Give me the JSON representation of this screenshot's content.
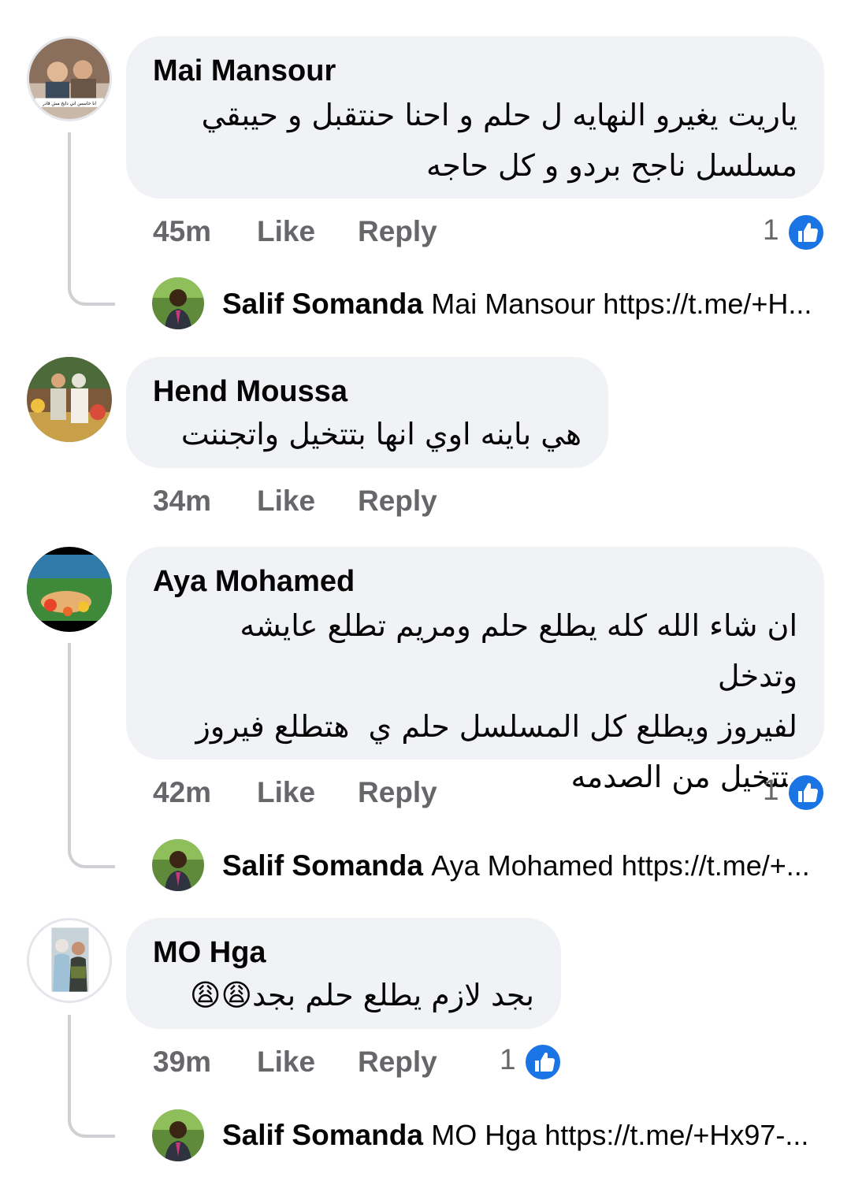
{
  "comments": [
    {
      "author": "Mai Mansour",
      "text_lines": [
        "ياريت يغيرو النهايه ل حلم و احنا حنتقبل و حيبقي",
        "مسلسل ناجح بردو و كل حاجه"
      ],
      "avatar_caption": "انا حاسس اني دايخ مش قادر",
      "time": "45m",
      "like_label": "Like",
      "reply_label": "Reply",
      "reaction_count": "1",
      "reaction_icon": "like-icon",
      "reply": {
        "author": "Salif Somanda",
        "text": "Mai Mansour https://t.me/+H..."
      }
    },
    {
      "author": "Hend Moussa",
      "text_lines": [
        "هي باينه اوي انها بتتخيل واتجننت"
      ],
      "time": "34m",
      "like_label": "Like",
      "reply_label": "Reply"
    },
    {
      "author": "Aya Mohamed",
      "text_lines": [
        "ان شاء الله كله يطلع حلم ومريم تطلع عايشه وتدخل",
        "لفيروز ويطلع كل المسلسل حلم ي  هتطلع فيروز",
        "بتتخيل من الصدمه"
      ],
      "time": "42m",
      "like_label": "Like",
      "reply_label": "Reply",
      "reaction_count": "1",
      "reaction_icon": "like-icon",
      "reply": {
        "author": "Salif Somanda",
        "text": "Aya Mohamed https://t.me/+..."
      }
    },
    {
      "author": "MO Hga",
      "text_lines": [
        "بجد لازم يطلع حلم بجد"
      ],
      "emoji": "😩😩",
      "time": "39m",
      "like_label": "Like",
      "reply_label": "Reply",
      "reaction_count": "1",
      "reaction_icon": "like-icon",
      "reply": {
        "author": "Salif Somanda",
        "text": "MO Hga https://t.me/+Hx97-..."
      }
    }
  ],
  "colors": {
    "bubble": "#f0f2f5",
    "text": "#050505",
    "secondary": "#65676b",
    "like_blue": "#1b74e4",
    "thread_line": "#ced0d4"
  }
}
